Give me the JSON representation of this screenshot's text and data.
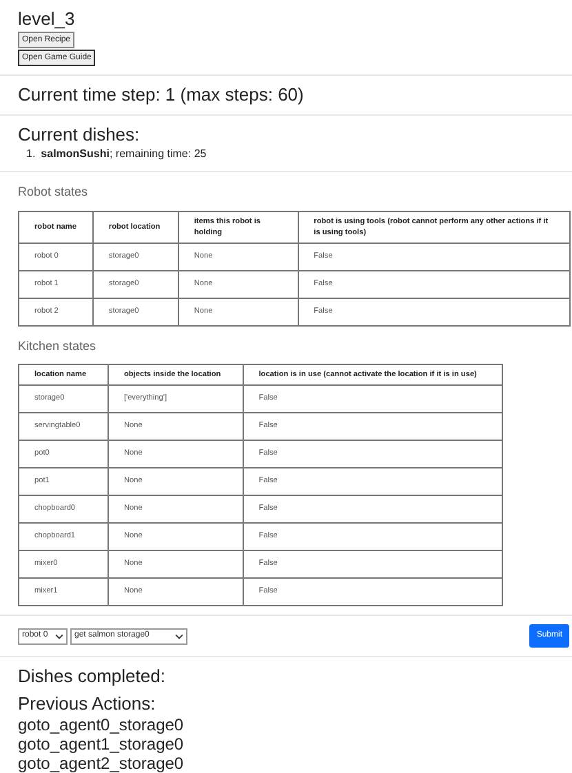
{
  "title": "level_3",
  "buttons": [
    "Open Recipe",
    "Open Game Guide"
  ],
  "time_step": "Current time step: 1 (max steps: 60)",
  "current_dishes": {
    "heading": "Current dishes:",
    "items": [
      {
        "number": "1.",
        "text": "**salmonSushi**; remaining time: 25"
      }
    ]
  },
  "robot_states": {
    "heading": "Robot states",
    "columns": [
      "robot name",
      "robot location",
      "items this robot is holding",
      "robot is using tools (robot cannot perform any other actions if it is using tools)"
    ],
    "rows": [
      [
        "robot 0",
        "storage0",
        "None",
        "False"
      ],
      [
        "robot 1",
        "storage0",
        "None",
        "False"
      ],
      [
        "robot 2",
        "storage0",
        "None",
        "False"
      ]
    ]
  },
  "kitchen_states": {
    "heading": "Kitchen states",
    "columns": [
      "location name",
      "objects inside the location",
      "location is in use (cannot activate the location if it is in use)"
    ],
    "rows": [
      [
        "storage0",
        "['everything']",
        "False"
      ],
      [
        "servingtable0",
        "None",
        "False"
      ],
      [
        "pot0",
        "None",
        "False"
      ],
      [
        "pot1",
        "None",
        "False"
      ],
      [
        "chopboard0",
        "None",
        "False"
      ],
      [
        "chopboard1",
        "None",
        "False"
      ],
      [
        "mixer0",
        "None",
        "False"
      ],
      [
        "mixer1",
        "None",
        "False"
      ]
    ]
  },
  "action_form": {
    "robot_select": {
      "value": "robot 0"
    },
    "action_select": {
      "value": "get salmon storage0"
    },
    "submit": "Submit"
  },
  "dishes_completed": "Dishes completed:",
  "previous_actions": {
    "heading": "Previous Actions:",
    "items": [
      "goto_agent0_storage0",
      "goto_agent1_storage0",
      "goto_agent2_storage0"
    ]
  }
}
